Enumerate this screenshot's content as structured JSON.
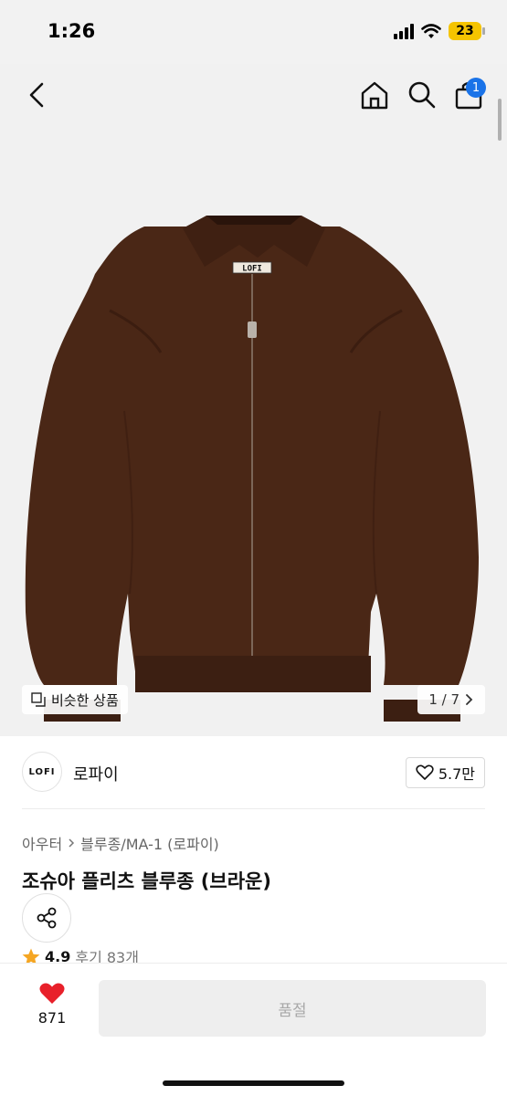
{
  "status_bar": {
    "time": "1:26",
    "battery": "23"
  },
  "nav": {
    "cart_badge": "1"
  },
  "gallery": {
    "similar_label": "비슷한 상품",
    "page_indicator": "1 / 7",
    "jacket_label_text": "LOFI"
  },
  "brand": {
    "logo_text": "LOFI",
    "name": "로파이",
    "likes": "5.7만"
  },
  "breadcrumb": {
    "category": "아우터",
    "subcategory": "블루종/MA-1 (로파이)"
  },
  "product": {
    "title": "조슈아 플리츠 블루종 (브라운)"
  },
  "rating": {
    "value": "4.9",
    "reviews": "후기 83개"
  },
  "bottom_bar": {
    "wish_count": "871",
    "action_label": "품절"
  },
  "colors": {
    "accent": "#1a73e8",
    "heart": "#e8202a",
    "star": "#f5a623",
    "jacket": "#4a2716"
  },
  "icons": [
    "back-icon",
    "home-icon",
    "search-icon",
    "cart-icon",
    "copy-icon",
    "chevron-right-icon",
    "heart-outline-icon",
    "share-icon",
    "star-icon",
    "heart-filled-icon"
  ]
}
